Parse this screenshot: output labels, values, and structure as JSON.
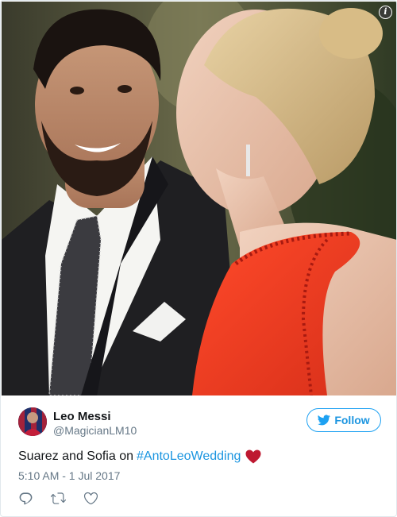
{
  "tweet": {
    "author_name": "Leo Messi",
    "author_handle": "@MagicianLM10",
    "follow_label": "Follow",
    "text_prefix": "Suarez and Sofia on",
    "hashtag": "#AntoLeoWedding",
    "emoji": "heart",
    "timestamp": "5:10 AM - 1 Jul 2017"
  },
  "media": {
    "info_badge": "i",
    "description_icon": "info-icon"
  },
  "icons": {
    "reply": "reply-icon",
    "retweet": "retweet-icon",
    "like": "like-icon",
    "follow": "twitter-bird-icon"
  },
  "colors": {
    "accent": "#1da1f2",
    "link": "#1b95e0",
    "muted": "#657786",
    "text": "#14171a",
    "heart": "#be1931"
  }
}
